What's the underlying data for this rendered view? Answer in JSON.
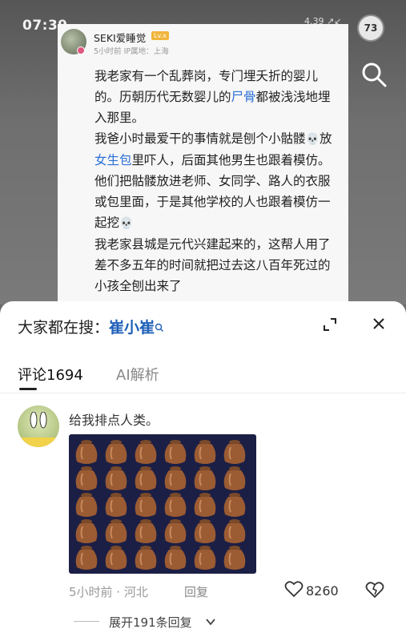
{
  "status": {
    "time": "07:39",
    "right": "4.39 ↗↙",
    "badge": "73"
  },
  "post": {
    "username": "SEKI爱睡觉",
    "level": "Lv.x",
    "meta": "5小时前 IP属地：上海",
    "p1_a": "我老家有一个乱葬岗，专门埋夭折的婴儿的。历朝历代无数婴儿的",
    "p1_link": "尸骨",
    "p1_b": "都被浅浅地埋入那里。",
    "p2_a": "我爸小时最爱干的事情就是刨个小骷髅",
    "p2_b": "放",
    "p2_link": "女生包",
    "p2_c": "里吓人，后面其他男生也跟着模仿。他们把骷髅放进老师、女同学、路人的衣服或包里面，于是其他学校的人也跟着模仿一起挖",
    "p3": "我老家县城是元代兴建起来的，这帮人用了差不多五年的时间就把过去这八百年死过的小孩全刨出来了",
    "skull": "💀"
  },
  "hot_search": {
    "label": "大家都在搜：",
    "term": "崔小崔"
  },
  "tabs": {
    "comments": "评论1694",
    "ai": "AI解析"
  },
  "comment": {
    "text": "给我排点人类。",
    "time_loc": "5小时前 · 河北",
    "reply": "回复",
    "likes": "8260"
  },
  "more_replies": "展开191条回复",
  "icons": {
    "search": "search-icon",
    "expand": "expand-icon",
    "close": "close-icon",
    "like": "heart-icon",
    "dislike": "broken-heart-icon"
  }
}
